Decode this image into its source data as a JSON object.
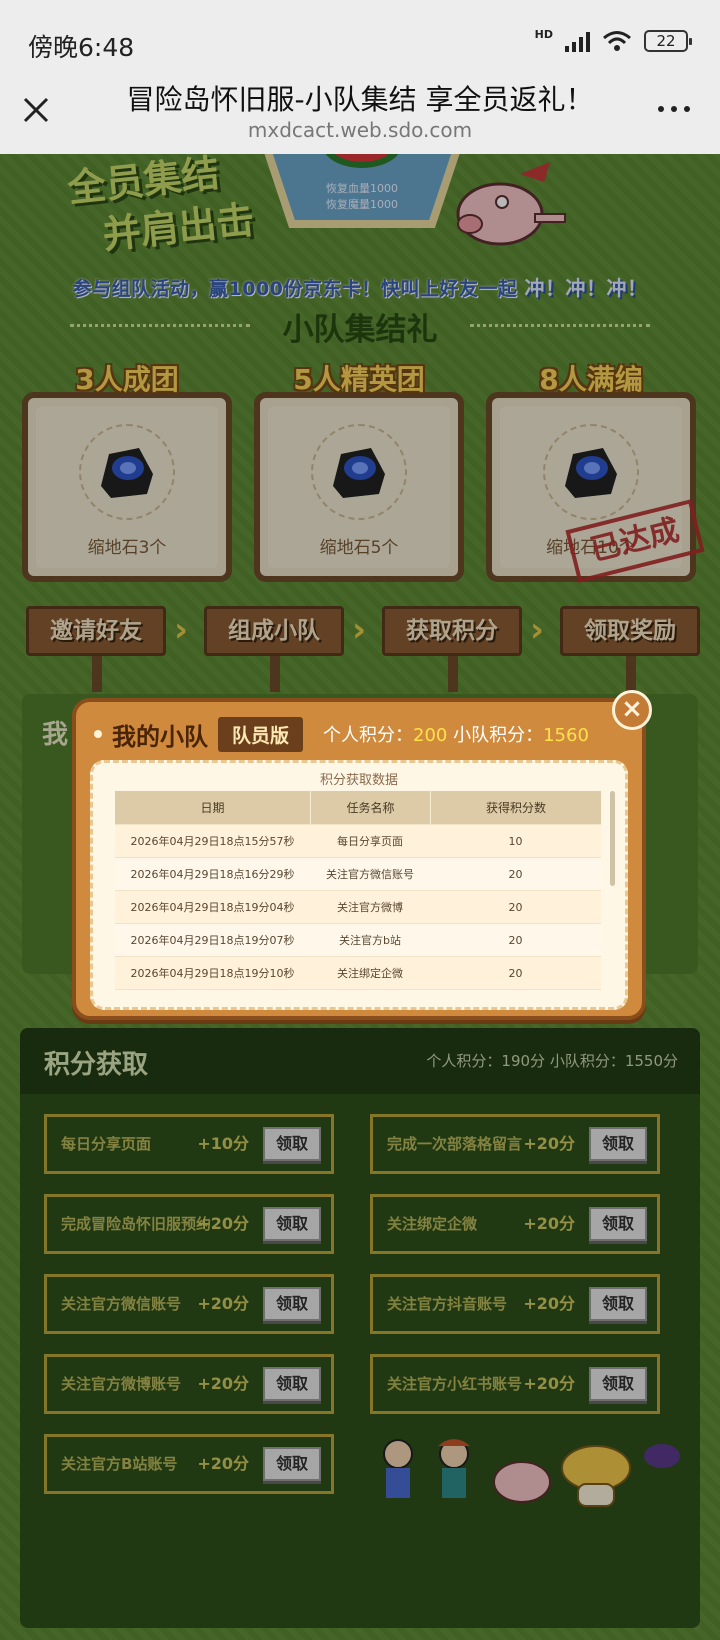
{
  "status": {
    "time": "傍晚6:48",
    "network": "HD",
    "battery": "22"
  },
  "browser": {
    "title": "冒险岛怀旧服-小队集结 享全员返礼！",
    "url": "mxdcact.web.sdo.com"
  },
  "hero": {
    "slogan_line1": "全员集结",
    "slogan_line2": "并肩出击",
    "hex_line1": "恢复血量1000",
    "hex_line2": "恢复魔量1000",
    "tagline_prefix": "参与组队活动，赢1000份京东卡！快叫上好友一起 ",
    "tagline_emph": "冲！冲！冲！"
  },
  "rewards": {
    "section_title": "小队集结礼",
    "tiers": [
      {
        "title": "3人成团",
        "label": "缩地石3个"
      },
      {
        "title": "5人精英团",
        "label": "缩地石5个"
      },
      {
        "title": "8人满编",
        "label": "缩地石10个"
      }
    ],
    "stamp": "已达成"
  },
  "steps": [
    "邀请好友",
    "组成小队",
    "获取积分",
    "领取奖励"
  ],
  "team_section": {
    "title": "我"
  },
  "modal": {
    "title": "我的小队",
    "badge": "队员版",
    "personal_label": "个人积分：",
    "personal_value": "200",
    "team_label": "小队积分：",
    "team_value": "1560",
    "close": "×",
    "caption": "积分获取数据",
    "columns": [
      "日期",
      "任务名称",
      "获得积分数"
    ],
    "rows": [
      [
        "2026年04月29日18点15分57秒",
        "每日分享页面",
        "10"
      ],
      [
        "2026年04月29日18点16分29秒",
        "关注官方微信账号",
        "20"
      ],
      [
        "2026年04月29日18点19分04秒",
        "关注官方微博",
        "20"
      ],
      [
        "2026年04月29日18点19分07秒",
        "关注官方b站",
        "20"
      ],
      [
        "2026年04月29日18点19分10秒",
        "关注绑定企微",
        "20"
      ]
    ]
  },
  "points": {
    "title": "积分获取",
    "summary": "个人积分：190分    小队积分：1550分",
    "button_label": "领取",
    "tasks": [
      {
        "name": "每日分享页面",
        "pts": "+10分"
      },
      {
        "name": "完成一次部落格留言",
        "pts": "+20分"
      },
      {
        "name": "完成冒险岛怀旧服预约",
        "pts": "+20分"
      },
      {
        "name": "关注绑定企微",
        "pts": "+20分"
      },
      {
        "name": "关注官方微信账号",
        "pts": "+20分"
      },
      {
        "name": "关注官方抖音账号",
        "pts": "+20分"
      },
      {
        "name": "关注官方微博账号",
        "pts": "+20分"
      },
      {
        "name": "关注官方小红书账号",
        "pts": "+20分"
      },
      {
        "name": "关注官方B站账号",
        "pts": "+20分"
      }
    ]
  }
}
